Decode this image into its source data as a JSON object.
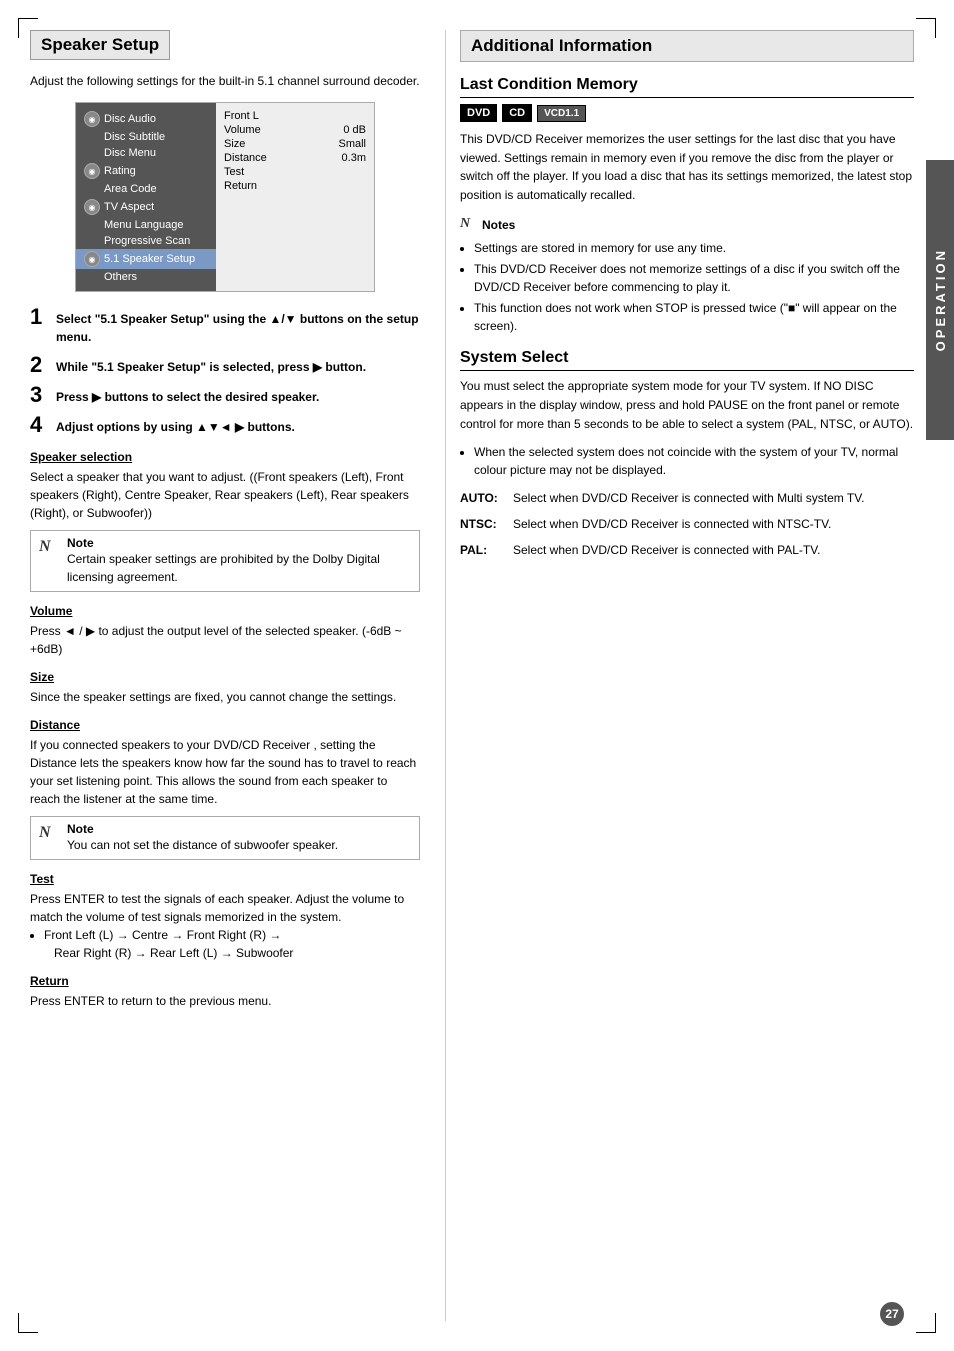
{
  "page": {
    "number": "27",
    "sidebar_label": "OPERATION"
  },
  "left": {
    "section_title": "Speaker Setup",
    "intro_text": "Adjust the following settings for the built-in 5.1 channel surround decoder.",
    "menu": {
      "left_items": [
        {
          "label": "Disc Audio",
          "has_icon": true,
          "active": false
        },
        {
          "label": "Disc Subtitle",
          "has_icon": false,
          "active": false
        },
        {
          "label": "Disc Menu",
          "has_icon": false,
          "active": false
        },
        {
          "label": "Rating",
          "has_icon": true,
          "active": false
        },
        {
          "label": "Area Code",
          "has_icon": false,
          "active": false
        },
        {
          "label": "TV Aspect",
          "has_icon": true,
          "active": false
        },
        {
          "label": "Menu Language",
          "has_icon": false,
          "active": false
        },
        {
          "label": "Progressive Scan",
          "has_icon": false,
          "active": false
        },
        {
          "label": "5.1 Speaker Setup",
          "has_icon": true,
          "active": true
        },
        {
          "label": "Others",
          "has_icon": false,
          "active": false
        }
      ],
      "right_rows": [
        {
          "label": "Front L",
          "value": ""
        },
        {
          "label": "Volume",
          "value": "0 dB"
        },
        {
          "label": "Size",
          "value": "Small"
        },
        {
          "label": "Distance",
          "value": "0.3m"
        },
        {
          "label": "Test",
          "value": ""
        },
        {
          "label": "Return",
          "value": ""
        }
      ]
    },
    "steps": [
      {
        "num": "1",
        "text": "Select \"5.1 Speaker Setup\" using the ▲/▼ buttons on the setup menu."
      },
      {
        "num": "2",
        "text": "While \"5.1 Speaker Setup\" is selected, press ▶ button."
      },
      {
        "num": "3",
        "text": "Press ▶ buttons to select the desired speaker."
      },
      {
        "num": "4",
        "text": "Adjust options by using ▲▼◄ ▶ buttons."
      }
    ],
    "subsections": [
      {
        "id": "speaker-selection",
        "title": "Speaker selection",
        "text": "Select a speaker that you want to adjust. ((Front speakers (Left), Front speakers (Right), Centre Speaker, Rear speakers (Left), Rear  speakers (Right), or Subwoofer))",
        "has_note": true,
        "note_text": "Certain speaker settings are prohibited by the Dolby Digital licensing agreement."
      },
      {
        "id": "volume",
        "title": "Volume",
        "text": "Press ◄ / ▶ to adjust the output level of the selected speaker. (-6dB ~ +6dB)"
      },
      {
        "id": "size",
        "title": "Size",
        "text": "Since the speaker settings are fixed, you cannot change the settings."
      },
      {
        "id": "distance",
        "title": "Distance",
        "text": "If you connected speakers to your DVD/CD Receiver , setting the Distance lets the speakers know how far the sound has to travel to reach your set listening point. This allows the sound from each speaker to reach the listener at the same time.",
        "has_note2": true,
        "note2_text": "You can not set the distance of subwoofer speaker."
      },
      {
        "id": "test",
        "title": "Test",
        "text": "Press ENTER to test the signals of each speaker. Adjust the volume to match the volume of test signals memorized in the system.",
        "bullet": "Front Left (L) → Centre → Front Right (R) → Rear Right (R) → Rear Left (L) → Subwoofer"
      },
      {
        "id": "return",
        "title": "Return",
        "text": "Press ENTER to return to the previous menu."
      }
    ]
  },
  "right": {
    "section_title": "Additional Information",
    "last_condition": {
      "title": "Last Condition Memory",
      "badges": [
        "DVD",
        "CD",
        "VCD1.1"
      ],
      "badge_styles": [
        "filled",
        "filled",
        "small-fill"
      ],
      "body_text": "This DVD/CD Receiver  memorizes the user settings for the last disc that you have viewed. Settings remain in memory even if you remove the disc from the player or switch off the player. If you load a disc that has its settings memorized, the latest stop position is automatically recalled.",
      "notes_label": "Notes",
      "notes_items": [
        "Settings are stored in memory for use any time.",
        "This DVD/CD Receiver does not memorize settings of a disc if you switch off the DVD/CD Receiver  before commencing to play it.",
        "This function does not work when STOP is pressed twice (\"■\" will appear on the screen)."
      ]
    },
    "system_select": {
      "title": "System Select",
      "body_text": "You must select the appropriate system mode for your TV system. If NO DISC appears in the display window, press and hold PAUSE on the front panel or remote control for more than 5 seconds to be able to select a system (PAL, NTSC, or AUTO).",
      "bullet_text": "When the selected system does not coincide with the system of your TV, normal colour picture may not be displayed.",
      "options": [
        {
          "label": "AUTO:",
          "text": "Select when DVD/CD Receiver is connected with Multi system TV."
        },
        {
          "label": "NTSC:",
          "text": "Select when DVD/CD Receiver is connected with NTSC-TV."
        },
        {
          "label": "PAL:",
          "text": "Select when DVD/CD Receiver is connected with PAL-TV."
        }
      ]
    }
  }
}
